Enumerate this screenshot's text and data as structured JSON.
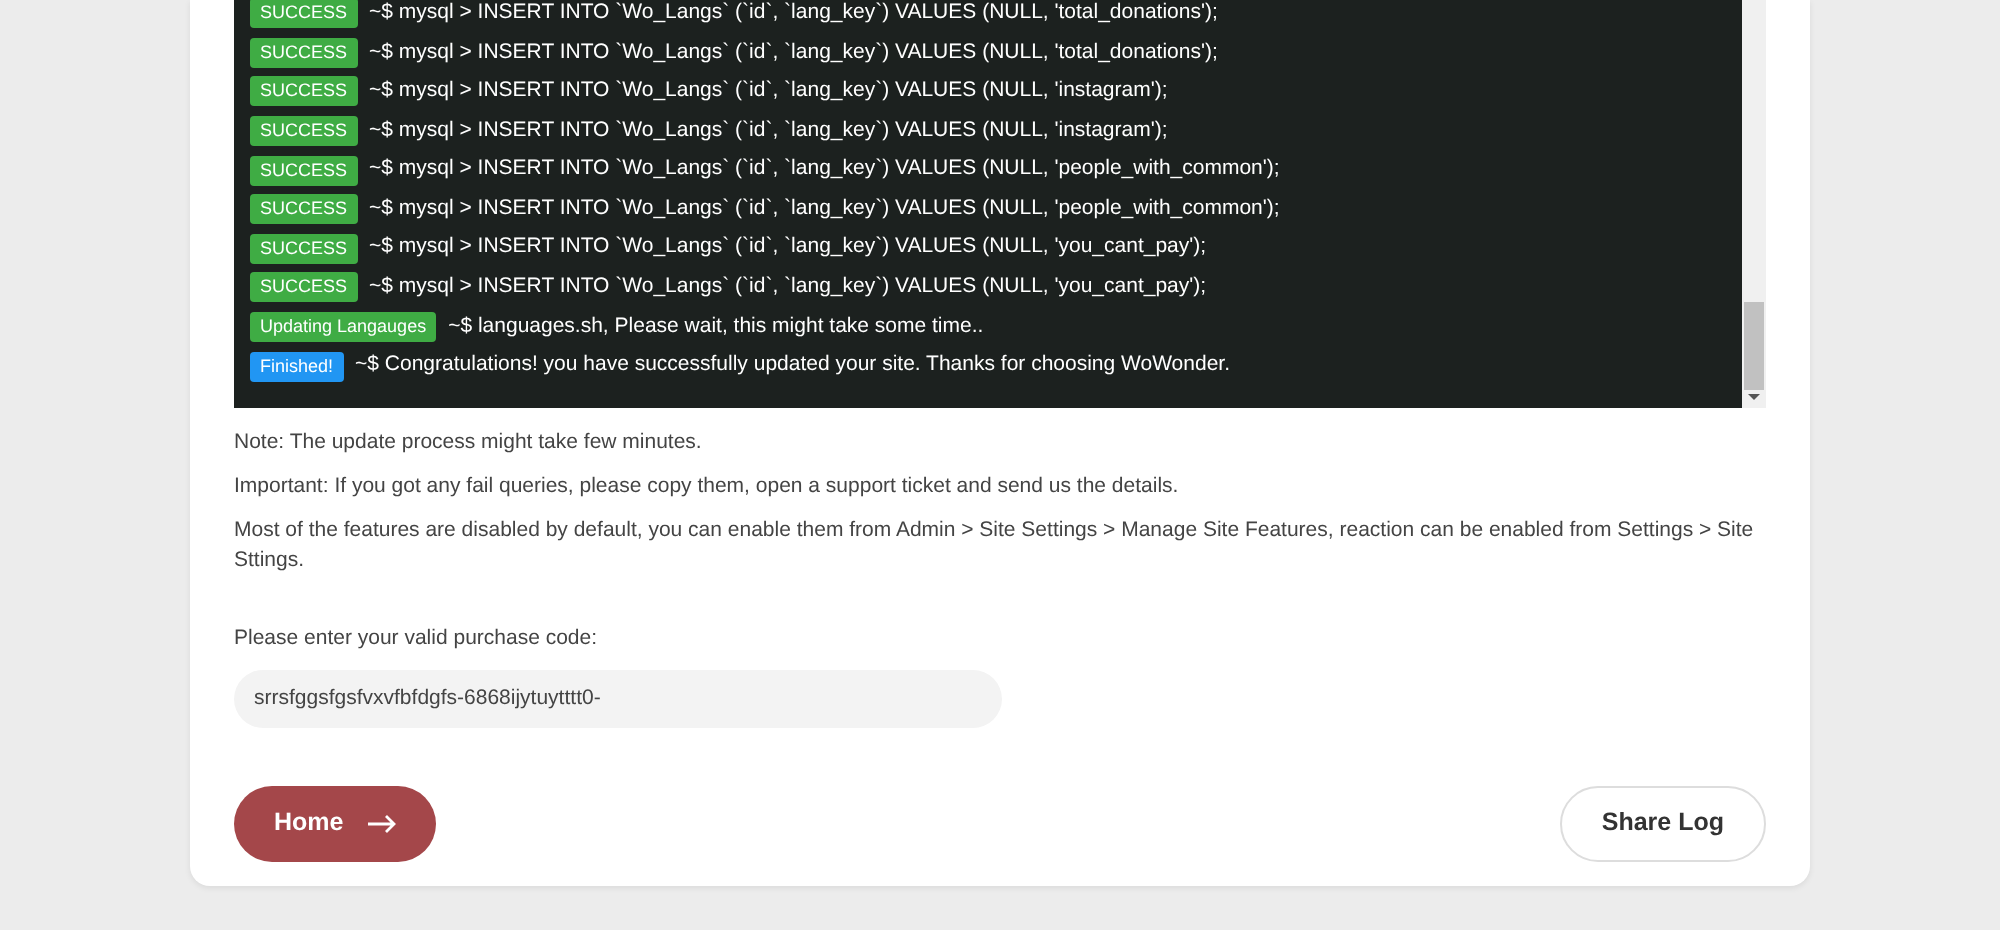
{
  "log": [
    {
      "kind": "success",
      "badge": "SUCCESS",
      "text": "~$ mysql > INSERT INTO `Wo_Langs` (`id`, `lang_key`) VALUES (NULL, 'total_donations');"
    },
    {
      "kind": "success",
      "badge": "SUCCESS",
      "text": "~$ mysql > INSERT INTO `Wo_Langs` (`id`, `lang_key`) VALUES (NULL, 'total_donations');"
    },
    {
      "kind": "success",
      "badge": "SUCCESS",
      "text": "~$ mysql > INSERT INTO `Wo_Langs` (`id`, `lang_key`) VALUES (NULL, 'instagram');"
    },
    {
      "kind": "success",
      "badge": "SUCCESS",
      "text": "~$ mysql > INSERT INTO `Wo_Langs` (`id`, `lang_key`) VALUES (NULL, 'instagram');"
    },
    {
      "kind": "success",
      "badge": "SUCCESS",
      "text": "~$ mysql > INSERT INTO `Wo_Langs` (`id`, `lang_key`) VALUES (NULL, 'people_with_common');"
    },
    {
      "kind": "success",
      "badge": "SUCCESS",
      "text": "~$ mysql > INSERT INTO `Wo_Langs` (`id`, `lang_key`) VALUES (NULL, 'people_with_common');"
    },
    {
      "kind": "success",
      "badge": "SUCCESS",
      "text": "~$ mysql > INSERT INTO `Wo_Langs` (`id`, `lang_key`) VALUES (NULL, 'you_cant_pay');"
    },
    {
      "kind": "success",
      "badge": "SUCCESS",
      "text": "~$ mysql > INSERT INTO `Wo_Langs` (`id`, `lang_key`) VALUES (NULL, 'you_cant_pay');"
    },
    {
      "kind": "success",
      "badge": "Updating Langauges",
      "text": "~$ languages.sh, Please wait, this might take some time.."
    },
    {
      "kind": "info",
      "badge": "Finished!",
      "text": "~$ Congratulations! you have successfully updated your site. Thanks for choosing WoWonder."
    }
  ],
  "notes": [
    "Note: The update process might take few minutes.",
    "Important: If you got any fail queries, please copy them, open a support ticket and send us the details.",
    "Most of the features are disabled by default, you can enable them from Admin > Site Settings > Manage Site Features, reaction can be enabled from Settings > Site Sttings."
  ],
  "purchase": {
    "label": "Please enter your valid purchase code:",
    "value": "srrsfggsfgsfvxvfbfdgfs-6868ijytuytttt0-"
  },
  "buttons": {
    "home": "Home",
    "share": "Share Log"
  }
}
